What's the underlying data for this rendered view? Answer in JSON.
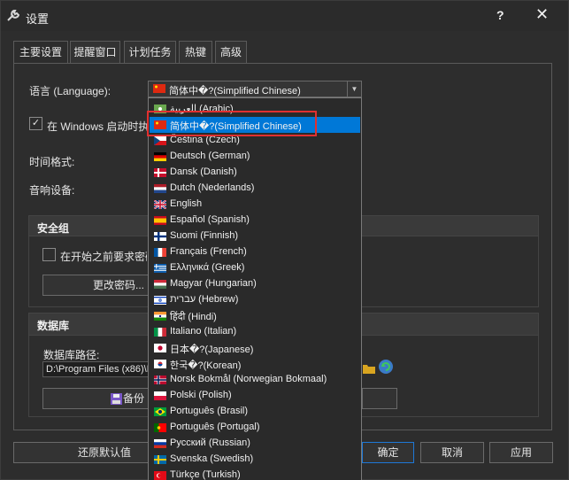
{
  "window": {
    "title": "设置",
    "help_label": "?",
    "close_label": "✕"
  },
  "tabs": [
    {
      "label": "主要设置",
      "active": true
    },
    {
      "label": "提醒窗口",
      "active": false
    },
    {
      "label": "计划任务",
      "active": false
    },
    {
      "label": "热键",
      "active": false
    },
    {
      "label": "高级",
      "active": false
    }
  ],
  "general": {
    "language_label": "语言 (Language):",
    "language_value": "简体中�?(Simplified Chinese)",
    "startup_label": "在 Windows 启动时执行",
    "startup_checked": true,
    "time_format_label": "时间格式:",
    "audio_device_label": "音响设备:"
  },
  "security": {
    "title": "安全组",
    "require_password_label": "在开始之前要求密码",
    "change_password_label": "更改密码..."
  },
  "database": {
    "title": "数据库",
    "path_label": "数据库路径:",
    "path_value": "D:\\Program Files (x86)\\H",
    "backup_label": "备份"
  },
  "footer": {
    "restore_defaults_label": "还原默认值",
    "ok_label": "确定",
    "cancel_label": "取消",
    "apply_label": "应用"
  },
  "languages": [
    {
      "name": "العربية (Arabic)",
      "flag": "arabic"
    },
    {
      "name": "简体中�?(Simplified Chinese)",
      "flag": "china",
      "selected": true
    },
    {
      "name": "Čeština (Czech)",
      "flag": "czech"
    },
    {
      "name": "Deutsch (German)",
      "flag": "germany"
    },
    {
      "name": "Dansk (Danish)",
      "flag": "denmark"
    },
    {
      "name": "Dutch (Nederlands)",
      "flag": "netherlands"
    },
    {
      "name": "English",
      "flag": "uk"
    },
    {
      "name": "Español (Spanish)",
      "flag": "spain"
    },
    {
      "name": "Suomi (Finnish)",
      "flag": "finland"
    },
    {
      "name": "Français (French)",
      "flag": "france"
    },
    {
      "name": "Ελληνικά (Greek)",
      "flag": "greece"
    },
    {
      "name": "Magyar (Hungarian)",
      "flag": "hungary"
    },
    {
      "name": "עברית (Hebrew)",
      "flag": "israel"
    },
    {
      "name": "हिंदी (Hindi)",
      "flag": "india"
    },
    {
      "name": "Italiano (Italian)",
      "flag": "italy"
    },
    {
      "name": "日本�?(Japanese)",
      "flag": "japan"
    },
    {
      "name": "한국�?(Korean)",
      "flag": "korea"
    },
    {
      "name": "Norsk Bokmål (Norwegian Bokmaal)",
      "flag": "norway"
    },
    {
      "name": "Polski (Polish)",
      "flag": "poland"
    },
    {
      "name": "Português (Brasil)",
      "flag": "brazil"
    },
    {
      "name": "Português (Portugal)",
      "flag": "portugal"
    },
    {
      "name": "Русский (Russian)",
      "flag": "russia"
    },
    {
      "name": "Svenska (Swedish)",
      "flag": "sweden"
    },
    {
      "name": "Türkçe (Turkish)",
      "flag": "turkey"
    }
  ],
  "colors": {
    "accent": "#0078d7",
    "highlight_box": "#e03030",
    "background": "#2d2d2d"
  }
}
